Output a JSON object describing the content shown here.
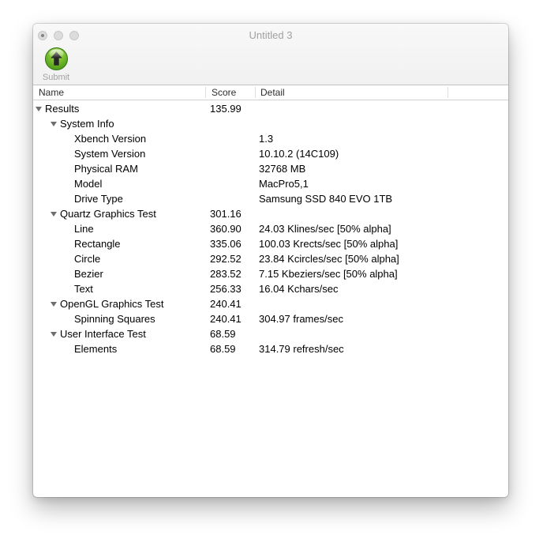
{
  "window": {
    "title": "Untitled 3"
  },
  "traffic_lights": {
    "close_has_dot": true
  },
  "toolbar": {
    "submit": {
      "label": "Submit",
      "icon": "green-orb-up-arrow"
    }
  },
  "table": {
    "columns": [
      "Name",
      "Score",
      "Detail"
    ],
    "rows": [
      {
        "level": 0,
        "expandable": true,
        "name": "Results",
        "score": "135.99",
        "detail": ""
      },
      {
        "level": 1,
        "expandable": true,
        "name": "System Info",
        "score": "",
        "detail": ""
      },
      {
        "level": 2,
        "expandable": false,
        "name": "Xbench Version",
        "score": "",
        "detail": "1.3"
      },
      {
        "level": 2,
        "expandable": false,
        "name": "System Version",
        "score": "",
        "detail": "10.10.2 (14C109)"
      },
      {
        "level": 2,
        "expandable": false,
        "name": "Physical RAM",
        "score": "",
        "detail": "32768 MB"
      },
      {
        "level": 2,
        "expandable": false,
        "name": "Model",
        "score": "",
        "detail": "MacPro5,1"
      },
      {
        "level": 2,
        "expandable": false,
        "name": "Drive Type",
        "score": "",
        "detail": "Samsung SSD 840 EVO 1TB"
      },
      {
        "level": 1,
        "expandable": true,
        "name": "Quartz Graphics Test",
        "score": "301.16",
        "detail": ""
      },
      {
        "level": 2,
        "expandable": false,
        "name": "Line",
        "score": "360.90",
        "detail": "24.03 Klines/sec [50% alpha]"
      },
      {
        "level": 2,
        "expandable": false,
        "name": "Rectangle",
        "score": "335.06",
        "detail": "100.03 Krects/sec [50% alpha]"
      },
      {
        "level": 2,
        "expandable": false,
        "name": "Circle",
        "score": "292.52",
        "detail": "23.84 Kcircles/sec [50% alpha]"
      },
      {
        "level": 2,
        "expandable": false,
        "name": "Bezier",
        "score": "283.52",
        "detail": "7.15 Kbeziers/sec [50% alpha]"
      },
      {
        "level": 2,
        "expandable": false,
        "name": "Text",
        "score": "256.33",
        "detail": "16.04 Kchars/sec"
      },
      {
        "level": 1,
        "expandable": true,
        "name": "OpenGL Graphics Test",
        "score": "240.41",
        "detail": ""
      },
      {
        "level": 2,
        "expandable": false,
        "name": "Spinning Squares",
        "score": "240.41",
        "detail": "304.97 frames/sec"
      },
      {
        "level": 1,
        "expandable": true,
        "name": "User Interface Test",
        "score": "68.59",
        "detail": ""
      },
      {
        "level": 2,
        "expandable": false,
        "name": "Elements",
        "score": "68.59",
        "detail": "314.79 refresh/sec"
      }
    ]
  },
  "colors": {
    "submit_orb_green": "#5fae1d",
    "submit_orb_dark_green": "#3c8a10",
    "chrome_background": "#f5f5f5",
    "inactive_text_gray": "#a1a1a1",
    "disclosure_triangle": "#6e6e6e"
  }
}
